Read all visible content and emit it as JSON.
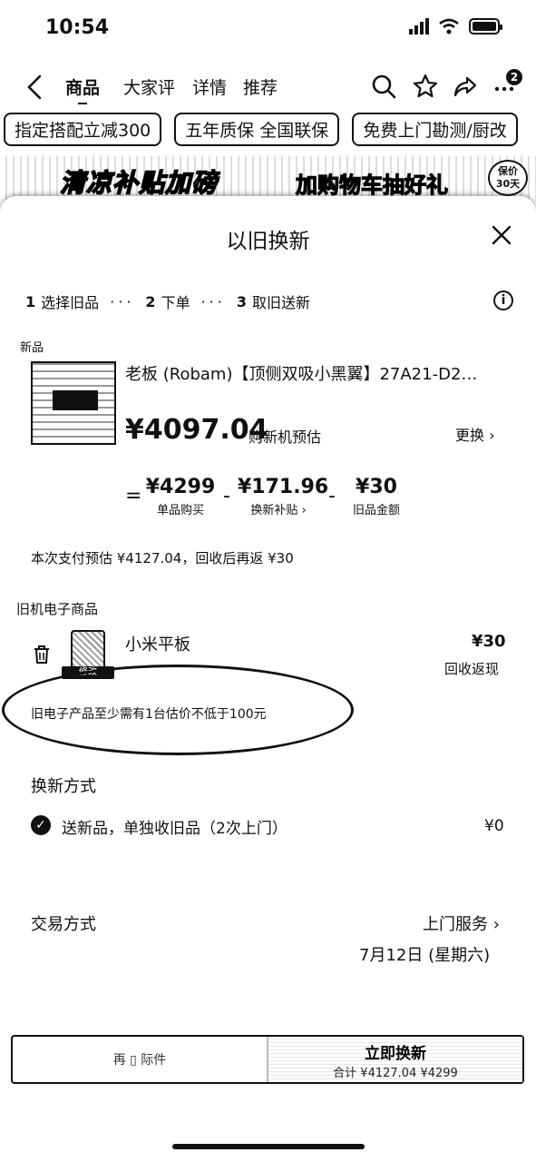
{
  "status_bar": {
    "time": "10:54"
  },
  "nav": {
    "tabs": [
      "商品",
      "大家评",
      "详情",
      "推荐"
    ],
    "badge_count": "2"
  },
  "chips": [
    "指定搭配立减300",
    "五年质保 全国联保",
    "免费上门勘测/厨改"
  ],
  "banner": {
    "left_text": "清凉补贴加磅",
    "right_text": "加购物车抽好礼",
    "seal_line1": "保价",
    "seal_line2": "30天"
  },
  "sheet": {
    "title": "以旧换新",
    "steps": [
      {
        "num": "1",
        "label": "选择旧品"
      },
      {
        "num": "2",
        "label": "下单"
      },
      {
        "num": "3",
        "label": "取旧送新"
      }
    ],
    "new_section_label": "新品",
    "product": {
      "name": "老板 (Robam)【顶侧双吸小黑翼】27A21-D2…",
      "price": "¥4097.04",
      "price_note": "购新机预估",
      "change_label": "更换 ›"
    },
    "calc": {
      "eq": "=",
      "minus": "-",
      "items": [
        {
          "value": "¥4299",
          "desc": "单品购买"
        },
        {
          "value": "¥171.96",
          "desc": "换新补贴 ›"
        },
        {
          "value": "¥30",
          "desc": "旧品金额"
        }
      ]
    },
    "pay_estimate": "本次支付预估 ¥4127.04，回收后再返 ¥30",
    "old_section_label": "旧机电子商品",
    "old_item": {
      "name": "小米平板",
      "price": "¥30",
      "desc": "回收返现",
      "modify_label": "修改"
    },
    "warning": "旧电子产品至少需有1台估价不低于100元",
    "method_title": "换新方式",
    "method": {
      "label": "送新品，单独收旧品（2次上门）",
      "price": "¥0"
    },
    "deal_title": "交易方式",
    "service": "上门服务 ›",
    "date": "7月12日 (星期六)",
    "bottom": {
      "left_label": "再 ▯ 际件",
      "right_line1": "立即换新",
      "right_line2": "合计 ¥4127.04 ¥4299"
    }
  }
}
